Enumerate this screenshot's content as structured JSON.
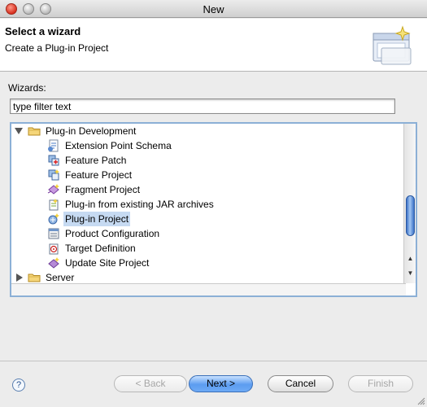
{
  "window": {
    "title": "New"
  },
  "header": {
    "title": "Select a wizard",
    "subtitle": "Create a Plug-in Project"
  },
  "wizards_label": "Wizards:",
  "filter": {
    "value": "type filter text"
  },
  "tree": {
    "items": [
      {
        "label": "Plug-in Development",
        "level": 0,
        "expanded": true,
        "icon": "folder-icon"
      },
      {
        "label": "Extension Point Schema",
        "level": 1,
        "icon": "schema-icon"
      },
      {
        "label": "Feature Patch",
        "level": 1,
        "icon": "feature-patch-icon"
      },
      {
        "label": "Feature Project",
        "level": 1,
        "icon": "feature-project-icon"
      },
      {
        "label": "Fragment Project",
        "level": 1,
        "icon": "fragment-project-icon"
      },
      {
        "label": "Plug-in from existing JAR archives",
        "level": 1,
        "icon": "jar-plugin-icon"
      },
      {
        "label": "Plug-in Project",
        "level": 1,
        "icon": "plugin-project-icon",
        "selected": true
      },
      {
        "label": "Product Configuration",
        "level": 1,
        "icon": "product-configuration-icon"
      },
      {
        "label": "Target Definition",
        "level": 1,
        "icon": "target-definition-icon"
      },
      {
        "label": "Update Site Project",
        "level": 1,
        "icon": "update-site-icon"
      },
      {
        "label": "Server",
        "level": 0,
        "expanded": false,
        "icon": "folder-icon"
      }
    ]
  },
  "buttons": {
    "back": "< Back",
    "next": "Next >",
    "cancel": "Cancel",
    "finish": "Finish",
    "help": "?"
  },
  "colors": {
    "selection": "#c6daf2",
    "accent": "#5c9cf0"
  }
}
